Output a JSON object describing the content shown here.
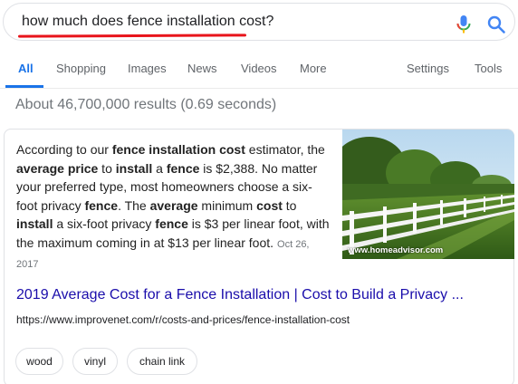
{
  "search": {
    "query": "how much does fence installation cost?",
    "mic_icon": "mic-icon",
    "search_icon": "search-icon",
    "underline_color": "#e8141b"
  },
  "tabs": [
    {
      "label": "All",
      "active": true
    },
    {
      "label": "Shopping"
    },
    {
      "label": "Images"
    },
    {
      "label": "News"
    },
    {
      "label": "Videos"
    },
    {
      "label": "More"
    },
    {
      "label": "Settings"
    },
    {
      "label": "Tools"
    }
  ],
  "result_stats": "About 46,700,000 results (0.69 seconds)",
  "snippet": {
    "segments": [
      {
        "t": "According to our "
      },
      {
        "t": "fence installation cost",
        "b": true
      },
      {
        "t": " estimator, the "
      },
      {
        "t": "average price",
        "b": true
      },
      {
        "t": " to "
      },
      {
        "t": "install",
        "b": true
      },
      {
        "t": " a "
      },
      {
        "t": "fence",
        "b": true
      },
      {
        "t": " is $2,388. No matter your preferred type, most homeowners choose a six-foot privacy "
      },
      {
        "t": "fence",
        "b": true
      },
      {
        "t": ". The "
      },
      {
        "t": "average",
        "b": true
      },
      {
        "t": " minimum "
      },
      {
        "t": "cost",
        "b": true
      },
      {
        "t": " to "
      },
      {
        "t": "install",
        "b": true
      },
      {
        "t": " a six-foot privacy "
      },
      {
        "t": "fence",
        "b": true
      },
      {
        "t": " is $3 per linear foot, with the maximum coming in at $13 per linear foot."
      }
    ],
    "date": "Oct 26, 2017",
    "image_credit": "www.homeadvisor.com",
    "title": "2019 Average Cost for a Fence Installation | Cost to Build a Privacy ...",
    "url": "https://www.improvenet.com/r/costs-and-prices/fence-installation-cost"
  },
  "chips": [
    "wood",
    "vinyl",
    "chain link"
  ],
  "colors": {
    "accent": "#1a73e8",
    "link": "#1a0dab"
  }
}
